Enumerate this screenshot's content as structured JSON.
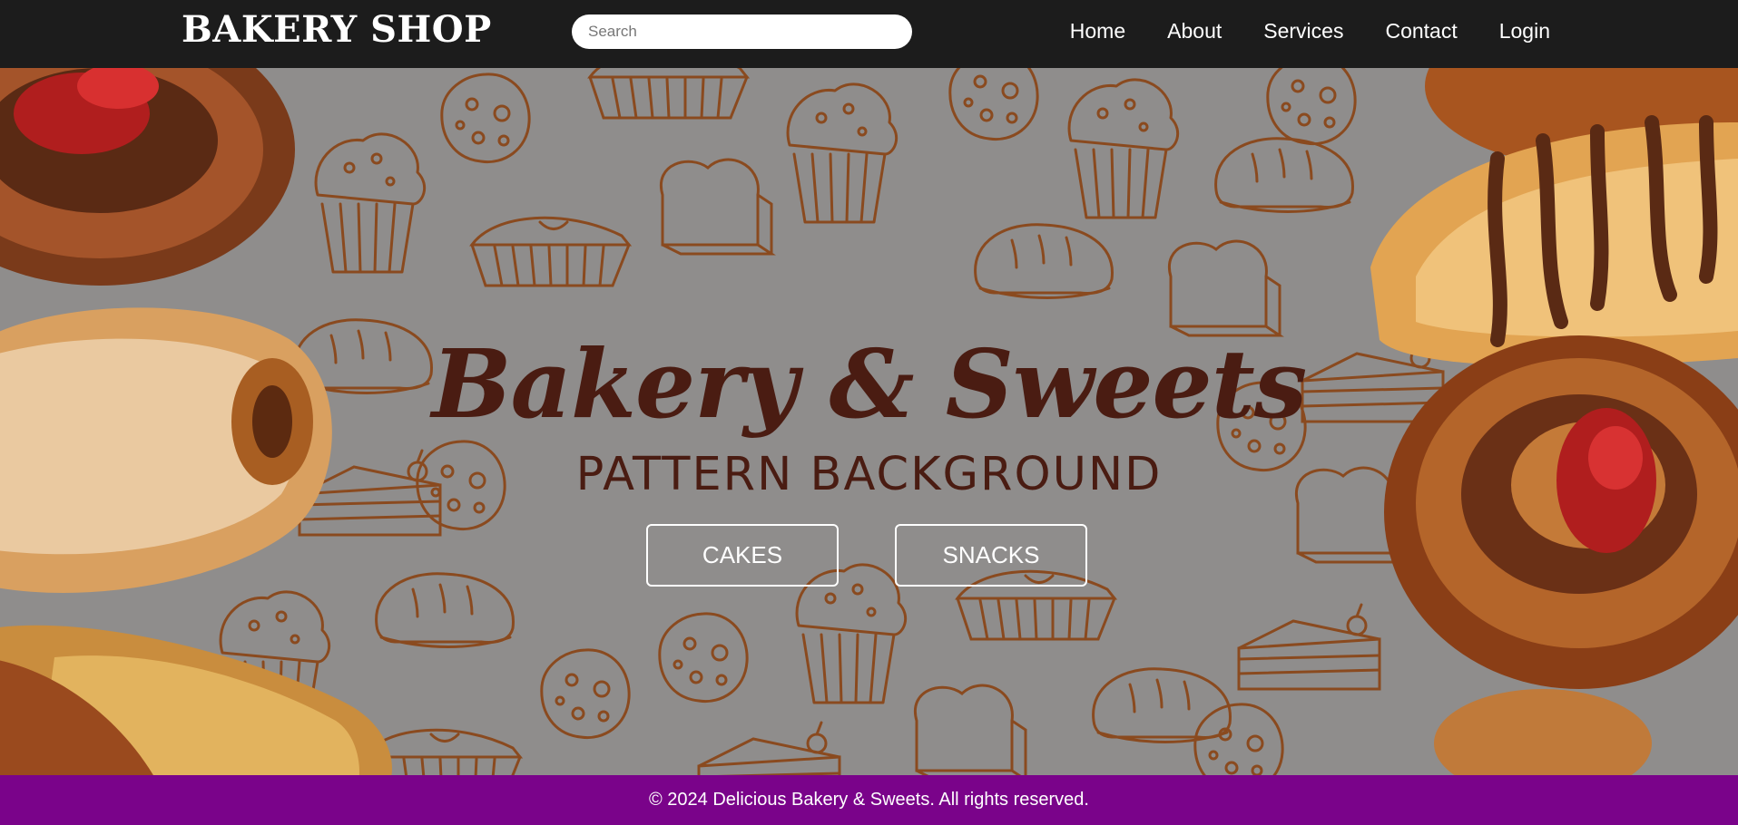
{
  "navbar": {
    "brand": "BAKERY SHOP",
    "search_placeholder": "Search",
    "links": [
      "Home",
      "About",
      "Services",
      "Contact",
      "Login"
    ]
  },
  "hero": {
    "headline": "Bakery & Sweets",
    "subheadline": "PATTERN BACKGROUND",
    "buttons": [
      "CAKES",
      "SNACKS"
    ]
  },
  "footer": {
    "text": "© 2024 Delicious Bakery & Sweets. All rights reserved."
  },
  "colors": {
    "navbar_bg": "#1c1c1c",
    "footer_bg": "#7a038a",
    "headline": "#4a1c12",
    "pattern_stroke": "#8a4a1f"
  }
}
